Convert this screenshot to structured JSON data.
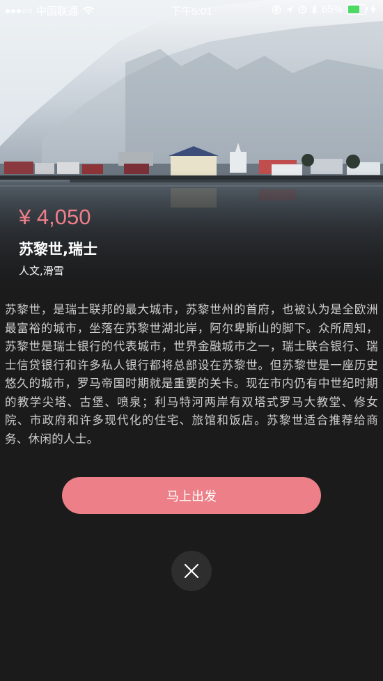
{
  "status_bar": {
    "carrier": "中国联通",
    "time": "下午5:01",
    "battery": "65%",
    "icons": [
      "signal-icon",
      "wifi-icon",
      "orientation-lock-icon",
      "location-icon",
      "alarm-icon",
      "bluetooth-icon",
      "battery-icon",
      "charging-icon"
    ],
    "battery_color": "#4cd964"
  },
  "hero": {
    "image": "snowy-mountain-lakeside-town",
    "price": "¥ 4,050",
    "price_color": "#ee7f8a",
    "city": "苏黎世,瑞士",
    "tags": "人文,滑雪"
  },
  "description": "苏黎世，是瑞士联邦的最大城市，苏黎世州的首府，也被认为是全欧洲最富裕的城市，坐落在苏黎世湖北岸，阿尔卑斯山的脚下。众所周知，苏黎世是瑞士银行的代表城市，世界金融城市之一，瑞士联合银行、瑞士信贷银行和许多私人银行都将总部设在苏黎世。但苏黎世是一座历史悠久的城市，罗马帝国时期就是重要的关卡。现在市内仍有中世纪时期的教学尖塔、古堡、喷泉；利马特河两岸有双塔式罗马大教堂、修女院、市政府和许多现代化的住宅、旅馆和饭店。苏黎世适合推荐给商务、休闲的人士。",
  "actions": {
    "go_label": "马上出发",
    "go_color": "#ec7f87",
    "close_icon": "close-icon"
  }
}
